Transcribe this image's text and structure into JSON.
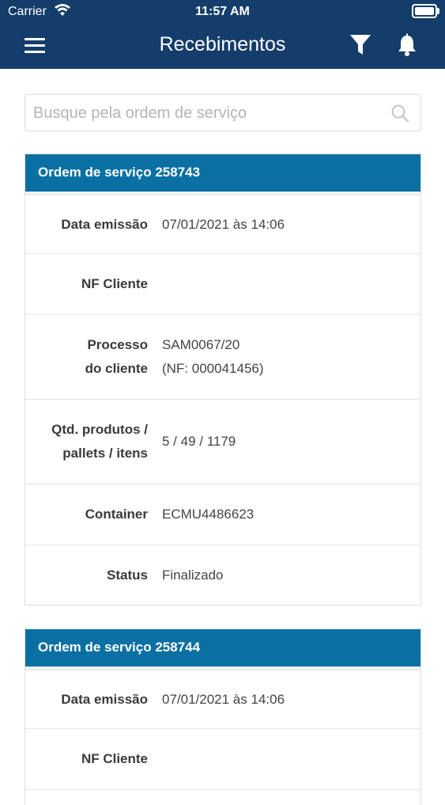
{
  "status_bar": {
    "carrier": "Carrier",
    "time": "11:57 AM"
  },
  "header": {
    "title": "Recebimentos"
  },
  "search": {
    "placeholder": "Busque pela ordem de serviço"
  },
  "orders": [
    {
      "title": "Ordem de serviço 258743",
      "fields": {
        "data_emissao": {
          "label": "Data emissão",
          "value": "07/01/2021 às 14:06"
        },
        "nf_cliente": {
          "label": "NF Cliente",
          "value": ""
        },
        "processo": {
          "label": "Processo\ndo cliente",
          "value": "SAM0067/20\n(NF: 000041456)"
        },
        "qtd": {
          "label": "Qtd. produtos /\npallets / itens",
          "value": "5 / 49 / 1179"
        },
        "container": {
          "label": "Container",
          "value": "ECMU4486623"
        },
        "status": {
          "label": "Status",
          "value": "Finalizado"
        }
      }
    },
    {
      "title": "Ordem de serviço 258744",
      "fields": {
        "data_emissao": {
          "label": "Data emissão",
          "value": "07/01/2021 às 14:06"
        },
        "nf_cliente": {
          "label": "NF Cliente",
          "value": ""
        }
      }
    }
  ],
  "colors": {
    "header_bg": "#153d6b",
    "card_head_bg": "#0a70a3"
  },
  "icons": [
    "wifi-icon",
    "battery-icon",
    "menu-icon",
    "filter-icon",
    "bell-icon",
    "search-icon"
  ]
}
